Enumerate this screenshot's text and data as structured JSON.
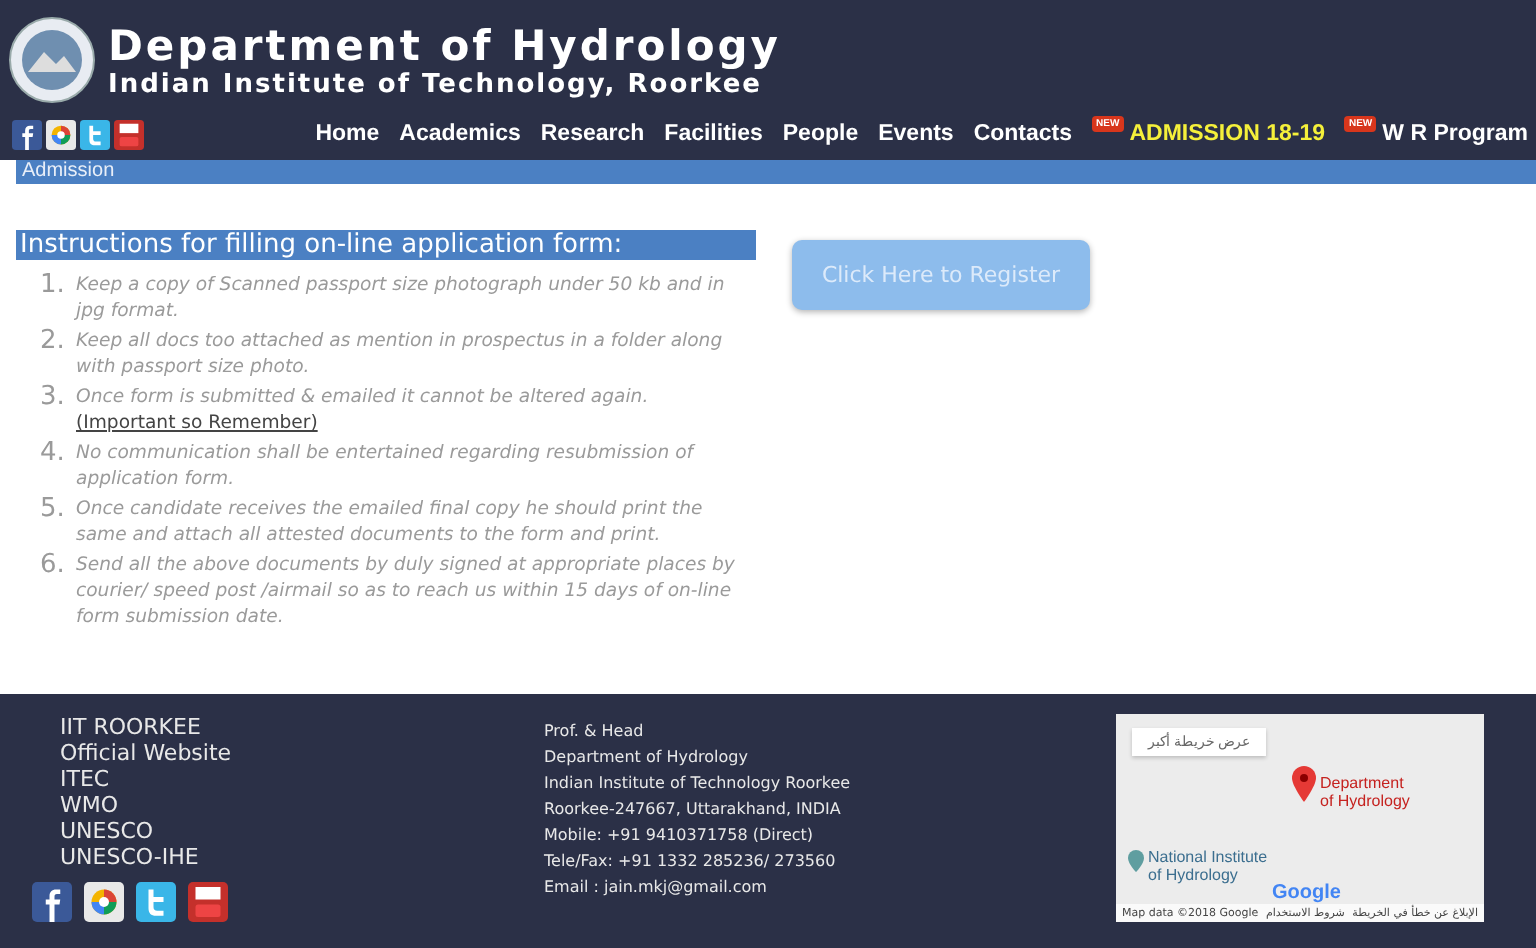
{
  "header": {
    "title": "Department of Hydrology",
    "subtitle": "Indian Institute of Technology, Roorkee"
  },
  "nav": [
    {
      "label": "Home",
      "highlighted": false
    },
    {
      "label": "Academics",
      "highlighted": false
    },
    {
      "label": "Research",
      "highlighted": false
    },
    {
      "label": "Facilities",
      "highlighted": false
    },
    {
      "label": "People",
      "highlighted": false
    },
    {
      "label": "Events",
      "highlighted": false
    },
    {
      "label": "Contacts",
      "highlighted": false
    },
    {
      "label": "ADMISSION 18-19",
      "highlighted": true,
      "badge": "NEW"
    },
    {
      "label": "W R Program",
      "highlighted": false,
      "badge": "NEW"
    }
  ],
  "breadcrumb": "Admission",
  "instructions": {
    "heading": "Instructions for filling on-line application form:",
    "items": [
      {
        "number": "1.",
        "text": "Keep a copy of Scanned passport size photograph under 50 kb and in jpg format."
      },
      {
        "number": "2.",
        "text": "Keep all docs too attached as mention in prospectus in a folder along with passport size photo."
      },
      {
        "number": "3.",
        "text": "Once form is submitted & emailed it cannot be altered again.",
        "link": "(Important so Remember)"
      },
      {
        "number": "4.",
        "text": "No communication shall be entertained regarding resubmission of application form."
      },
      {
        "number": "5.",
        "text": "Once candidate receives the emailed final copy he should print the same and attach all attested documents to the form and print."
      },
      {
        "number": "6.",
        "text": "Send all the above documents by duly signed at appropriate places by courier/ speed post /airmail so as to reach us within 15 days of on-line form submission date."
      }
    ]
  },
  "register_button": "Click Here to Register",
  "footer": {
    "links": [
      "IIT ROORKEE",
      "Official Website",
      "ITEC",
      "WMO",
      "UNESCO",
      "UNESCO-IHE"
    ],
    "address": [
      "Prof. & Head",
      "Department of Hydrology",
      "Indian Institute of Technology Roorkee",
      "Roorkee-247667, Uttarakhand, INDIA",
      "Mobile: +91 9410371758 (Direct)",
      "Tele/Fax: +91 1332 285236/ 273560",
      "Email : jain.mkj@gmail.com"
    ],
    "map": {
      "larger_map": "عرض خريطة أكبر",
      "pin_label": "Department of Hydrology",
      "place_label": "National Institute of Hydrology",
      "brand": "Google",
      "attribution": "Map data ©2018 Google",
      "terms": "شروط الاستخدام",
      "report": "الإبلاغ عن خطأ في الخريطة"
    }
  }
}
